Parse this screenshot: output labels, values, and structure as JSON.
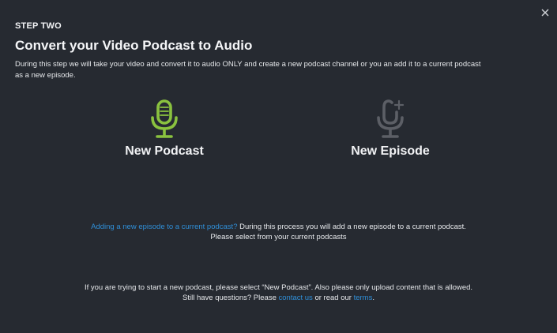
{
  "modal": {
    "step_label": "STEP TWO",
    "title": "Convert your Video Podcast to Audio",
    "description": "During this step we will take your video and convert it to audio ONLY and create a new podcast channel or you an add it to a current podcast as a new episode."
  },
  "options": {
    "new_podcast": {
      "label": "New Podcast",
      "icon": "microphone-icon",
      "color": "#8ac23f"
    },
    "new_episode": {
      "label": "New Episode",
      "icon": "microphone-plus-icon",
      "color": "#5c5f66"
    }
  },
  "episode_info": {
    "link_text": "Adding a new episode to a current podcast?",
    "line1_rest": " During this process you will add a new episode to a current podcast.",
    "line2": "Please select from your current podcasts"
  },
  "footer": {
    "line1": "If you are trying to start a new podcast, please select “New Podcast”. Also please only upload content that is allowed.",
    "line2_a": "Still have questions? Please ",
    "contact_link": "contact us",
    "line2_b": " or read our ",
    "terms_link": "terms",
    "line2_c": "."
  },
  "colors": {
    "background": "#262a31",
    "link": "#2f8fd8"
  }
}
